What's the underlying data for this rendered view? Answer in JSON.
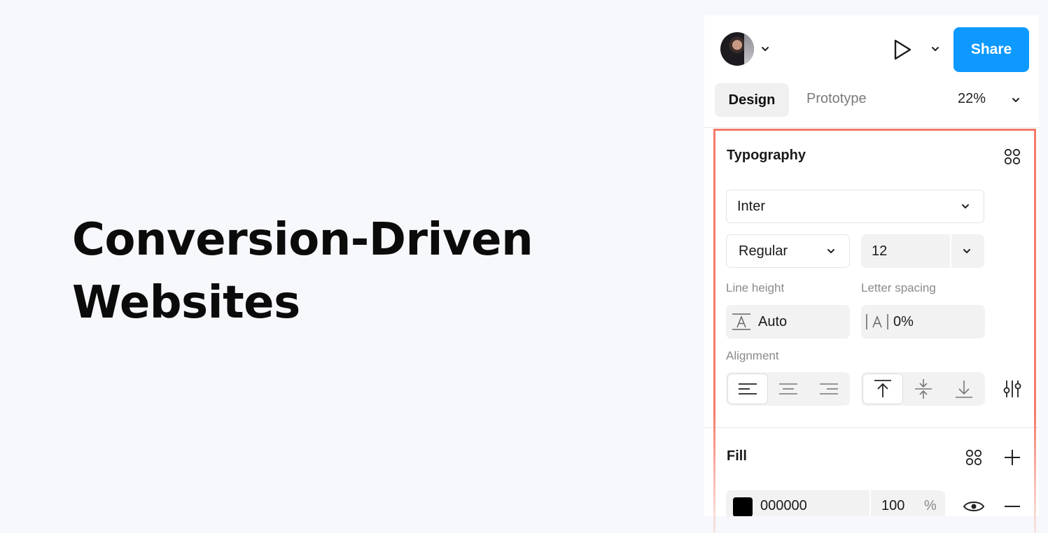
{
  "headline": {
    "line1": "Conversion-Driven",
    "line2": "Websites"
  },
  "header": {
    "share_label": "Share"
  },
  "tabs": {
    "design": "Design",
    "prototype": "Prototype",
    "zoom": "22%"
  },
  "typography": {
    "title": "Typography",
    "font_family": "Inter",
    "font_weight": "Regular",
    "font_size": "12",
    "line_height_label": "Line height",
    "line_height_value": "Auto",
    "letter_spacing_label": "Letter spacing",
    "letter_spacing_value": "0%",
    "alignment_label": "Alignment",
    "horizontal_selected": "left",
    "vertical_selected": "top"
  },
  "fill": {
    "title": "Fill",
    "hex": "000000",
    "opacity": "100",
    "opacity_unit": "%",
    "color": "#000000"
  },
  "colors": {
    "accent": "#0d99ff",
    "highlight": "#f47a6a"
  }
}
